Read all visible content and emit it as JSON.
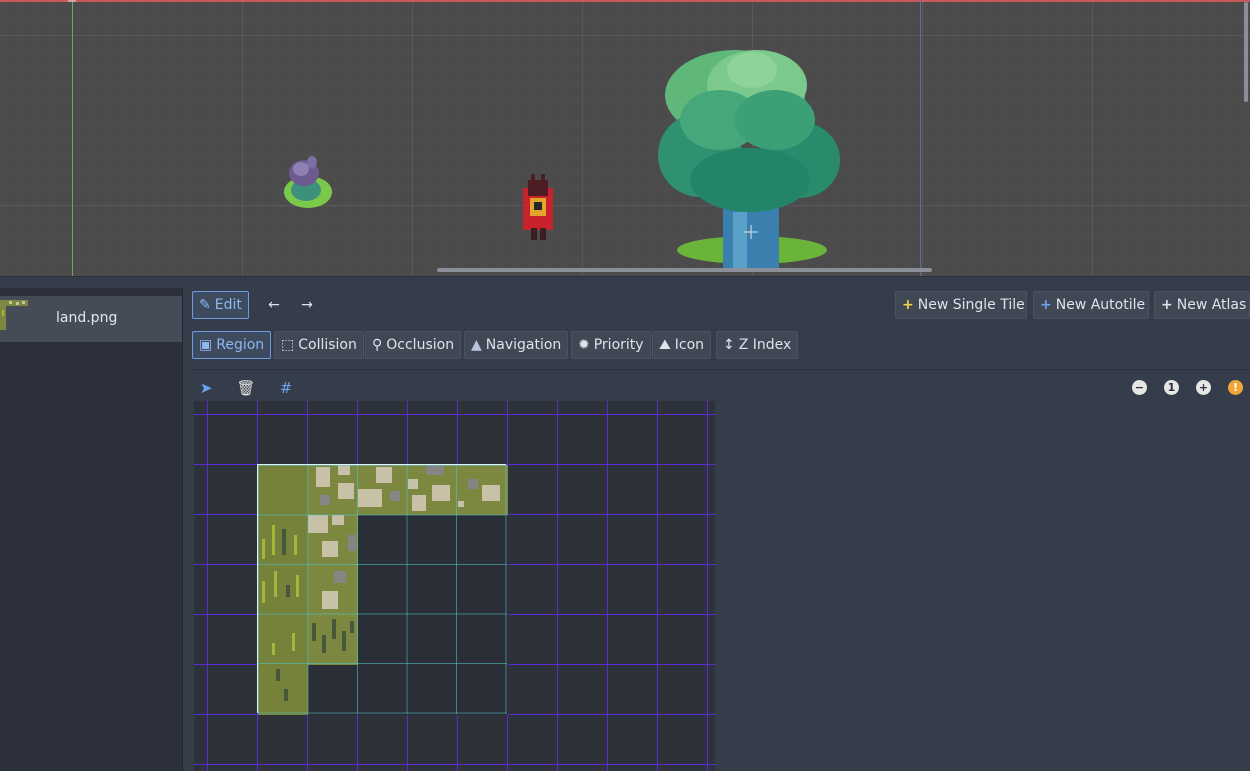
{
  "tileset": {
    "items": [
      {
        "label": "land.png"
      }
    ]
  },
  "toolbar": {
    "edit_label": "Edit",
    "new_single_tile": "New Single Tile",
    "new_autotile": "New Autotile",
    "new_atlas": "New Atlas"
  },
  "modes": {
    "region": "Region",
    "collision": "Collision",
    "occlusion": "Occlusion",
    "navigation": "Navigation",
    "priority": "Priority",
    "icon": "Icon",
    "z_index": "Z Index"
  },
  "zoom": {
    "reset_label": "1"
  },
  "colors": {
    "accent": "#6c9be0",
    "grid": "#5b2bd6",
    "grass": "#76813a",
    "viewport": "#4b4b4b",
    "panel": "#363d4a"
  },
  "icons": {
    "edit": "pencil-icon",
    "prev": "arrow-left-icon",
    "next": "arrow-right-icon",
    "select": "pointer-icon",
    "delete": "trash-icon",
    "snap": "grid-snap-icon",
    "zoom_out": "minus-circle-icon",
    "zoom_reset": "one-circle-icon",
    "zoom_in": "plus-circle-icon",
    "info": "info-icon"
  }
}
